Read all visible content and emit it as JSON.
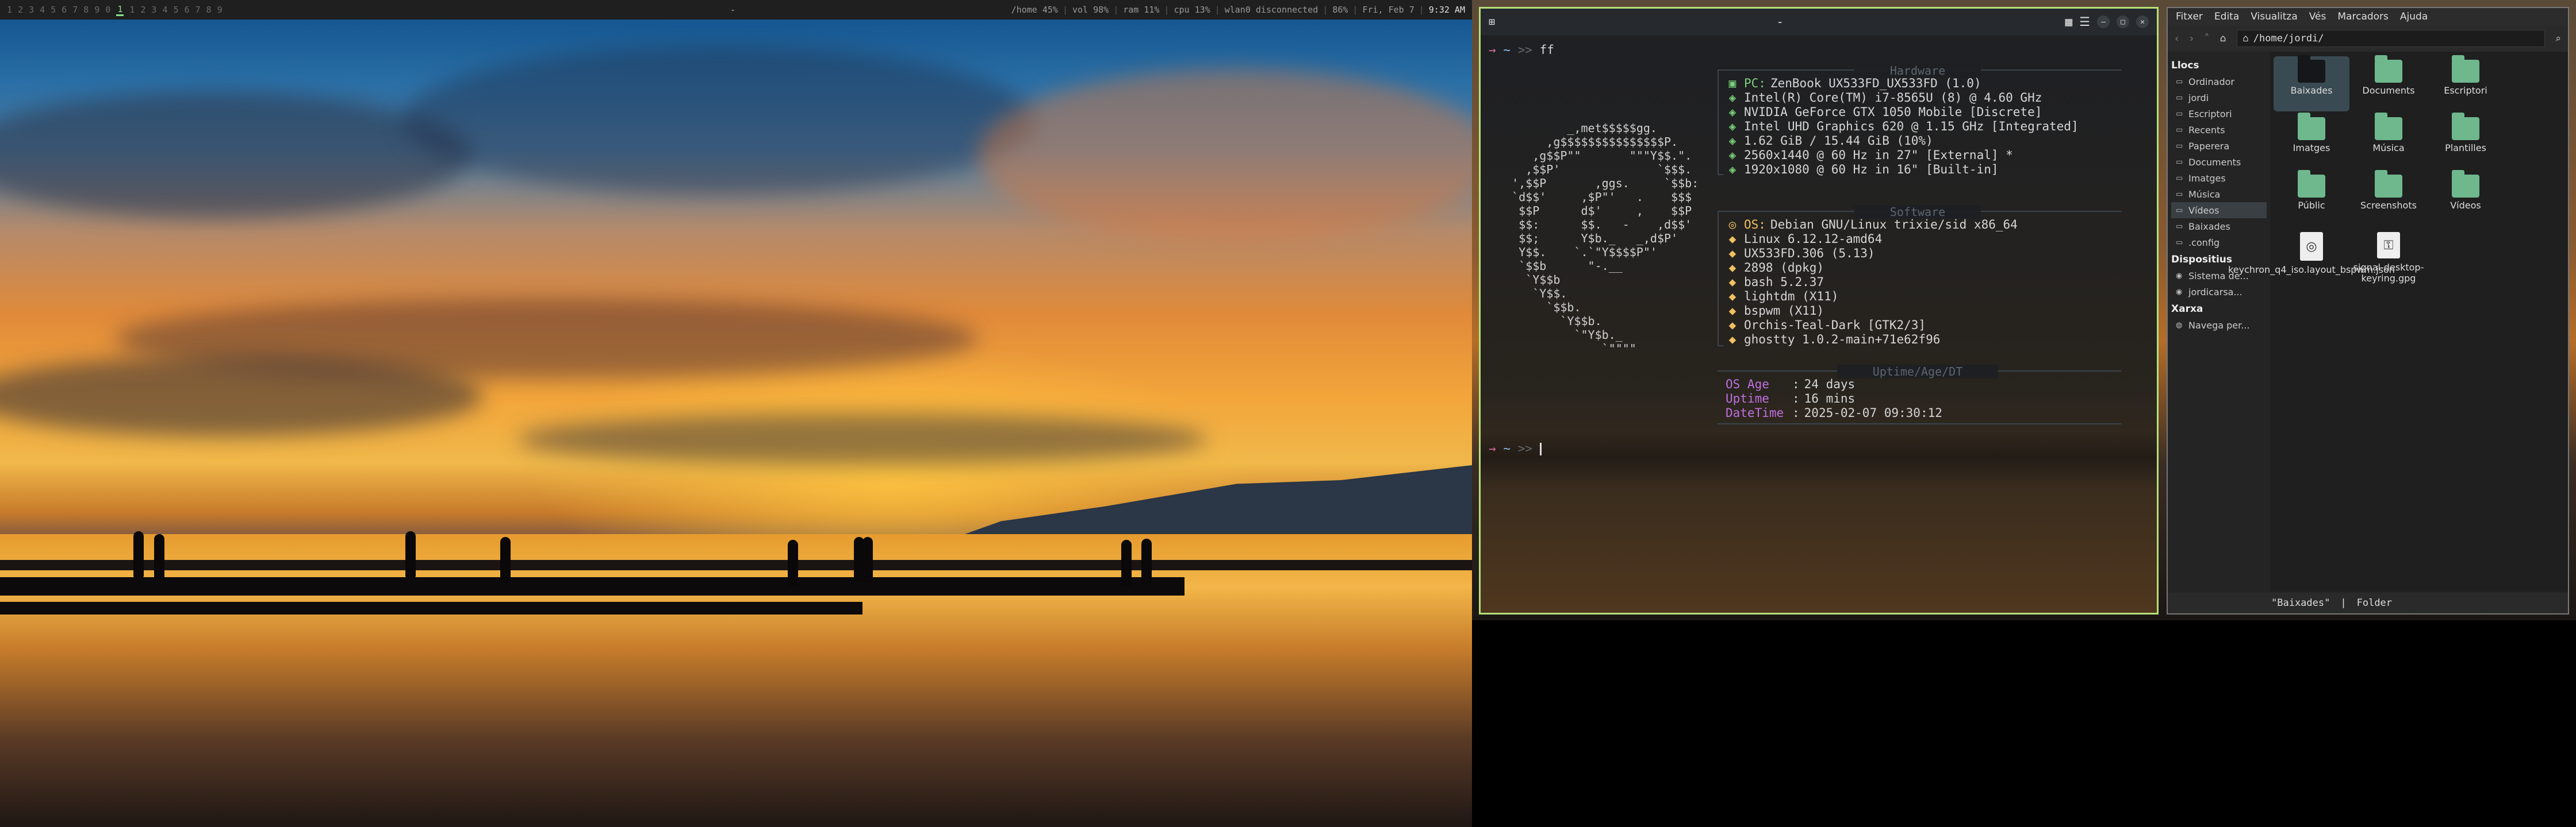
{
  "bar": {
    "workspaces_left": [
      "1",
      "2",
      "3",
      "4",
      "5",
      "6",
      "7",
      "8",
      "9",
      "0"
    ],
    "workspaces_right": [
      "1",
      "2",
      "3",
      "4",
      "5",
      "6",
      "7",
      "8",
      "9"
    ],
    "active_workspace": "1",
    "center": "-",
    "status": [
      "/home 45%",
      "vol 98%",
      "ram 11%",
      "cpu 13%",
      "wlan0 disconnected",
      "86%",
      "Fri, Feb 7",
      "9:32 AM"
    ],
    "accent": "#8be38b"
  },
  "terminal": {
    "title": "-",
    "border_color": "#b6e07a",
    "prompt": {
      "arrow": "→",
      "tilde": "~",
      "chev": ">>",
      "command": "ff"
    },
    "prompt2": {
      "arrow": "→",
      "tilde": "~",
      "chev": ">>"
    },
    "logo": "          _,met$$$$$gg.\n       ,g$$$$$$$$$$$$$$$P.\n     ,g$$P\"\"       \"\"\"Y$$.\".\n    ,$$P'              `$$$.\n  ',$$P       ,ggs.     `$$b:\n  `d$$'     ,$P\"'   .    $$$\n   $$P      d$'     ,    $$P\n   $$:      $$.   -    ,d$$'\n   $$;      Y$b._   _,d$P'\n   Y$$.    `.`\"Y$$$$P\"'\n   `$$b      \"-.__\n    `Y$$b\n     `Y$$.\n       `$$b.\n         `Y$$b.\n           `\"Y$b._\n               `\"\"\"\"",
    "sections": {
      "hardware": "Hardware",
      "software": "Software",
      "uptime": "Uptime/Age/DT"
    },
    "hardware": [
      {
        "label": "PC:",
        "value": "ZenBook UX533FD_UX533FD (1.0)"
      },
      {
        "label": "",
        "value": "Intel(R) Core(TM) i7-8565U (8) @ 4.60 GHz"
      },
      {
        "label": "",
        "value": "NVIDIA GeForce GTX 1050 Mobile [Discrete]"
      },
      {
        "label": "",
        "value": "Intel UHD Graphics 620 @ 1.15 GHz [Integrated]"
      },
      {
        "label": "",
        "value": "1.62 GiB / 15.44 GiB (10%)"
      },
      {
        "label": "",
        "value": "2560x1440 @ 60 Hz in 27\" [External] *"
      },
      {
        "label": "",
        "value": "1920x1080 @ 60 Hz in 16\" [Built-in]"
      }
    ],
    "software": [
      {
        "label": "OS:",
        "value": "Debian GNU/Linux trixie/sid x86_64"
      },
      {
        "label": "",
        "value": "Linux 6.12.12-amd64"
      },
      {
        "label": "",
        "value": "UX533FD.306 (5.13)"
      },
      {
        "label": "",
        "value": "2898 (dpkg)"
      },
      {
        "label": "",
        "value": "bash 5.2.37"
      },
      {
        "label": "",
        "value": "lightdm (X11)"
      },
      {
        "label": "",
        "value": "bspwm (X11)"
      },
      {
        "label": "",
        "value": "Orchis-Teal-Dark [GTK2/3]"
      },
      {
        "label": "",
        "value": "ghostty 1.0.2-main+71e62f96"
      }
    ],
    "uptime": [
      {
        "label": "OS Age",
        "value": "24 days"
      },
      {
        "label": "Uptime",
        "value": "16 mins"
      },
      {
        "label": "DateTime",
        "value": "2025-02-07 09:30:12"
      }
    ]
  },
  "filemanager": {
    "menu": [
      "Fitxer",
      "Edita",
      "Visualitza",
      "Vés",
      "Marcadors",
      "Ajuda"
    ],
    "path": "/home/jordi/",
    "sidebar": {
      "places_title": "Llocs",
      "places": [
        "Ordinador",
        "jordi",
        "Escriptori",
        "Recents",
        "Paperera",
        "Documents",
        "Imatges",
        "Música",
        "Vídeos",
        "Baixades",
        ".config"
      ],
      "devices_title": "Dispositius",
      "devices": [
        "Sistema de...",
        "jordicarsa..."
      ],
      "network_title": "Xarxa",
      "network": [
        "Navega per..."
      ],
      "selected": "Vídeos"
    },
    "items": [
      {
        "label": "Baixades",
        "kind": "folder-dark",
        "selected": true
      },
      {
        "label": "Documents",
        "kind": "folder"
      },
      {
        "label": "Escriptori",
        "kind": "folder"
      },
      {
        "label": "Imatges",
        "kind": "folder"
      },
      {
        "label": "Música",
        "kind": "folder"
      },
      {
        "label": "Plantilles",
        "kind": "folder"
      },
      {
        "label": "Públic",
        "kind": "folder"
      },
      {
        "label": "Screenshots",
        "kind": "folder"
      },
      {
        "label": "Vídeos",
        "kind": "folder"
      },
      {
        "label": "keychron_q4_iso.layout_bspwm.json",
        "kind": "file"
      },
      {
        "label": "signal-desktop-keyring.gpg",
        "kind": "file"
      }
    ],
    "status": {
      "selection": "\"Baixades\"",
      "sep": "|",
      "type": "Folder"
    }
  }
}
